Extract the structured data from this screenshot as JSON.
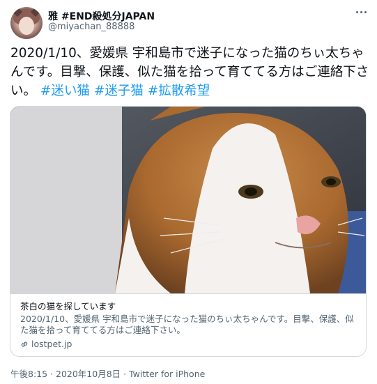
{
  "tweet": {
    "author_name": "雅 #END殺処分JAPAN",
    "author_handle": "@miyachan_88888",
    "text_plain": "2020/1/10、愛媛県 宇和島市で迷子になった猫のちぃ太ちゃんです。目撃、保護、似た猫を拾って育ててる方はご連絡下さい。",
    "hashtags": [
      "#迷い猫",
      "#迷子猫",
      "#拡散希望"
    ],
    "timestamp": "午後8:15 · 2020年10月8日 ·",
    "source": "Twitter for iPhone"
  },
  "card": {
    "title": "茶白の猫を探しています",
    "description": "2020/1/10、愛媛県 宇和島市で迷子になった猫のちぃ太ちゃんです。目撃、保護、似た猫を拾って育ててる方はご連絡下さい。",
    "domain": "lostpet.jp",
    "image_icon": "cat-photo"
  },
  "icons": {
    "more": "more-options-icon",
    "link": "link-icon"
  },
  "colors": {
    "accent": "#1d9bf0",
    "secondary_text": "#536471",
    "border": "#cfd9de"
  }
}
